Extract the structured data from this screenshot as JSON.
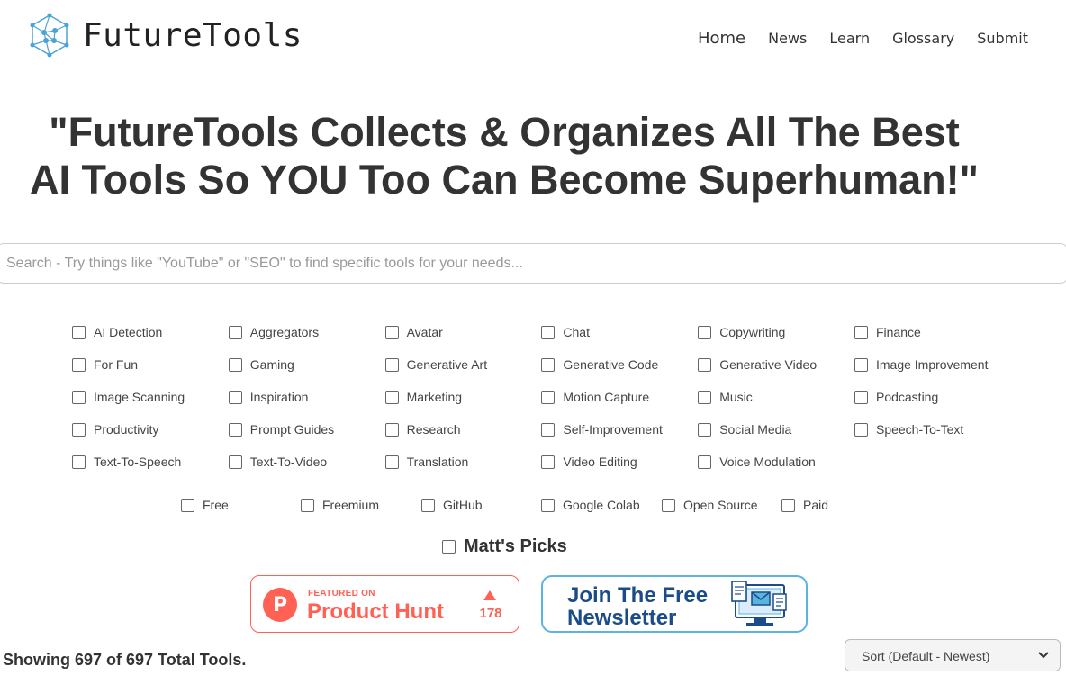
{
  "header": {
    "brand": "FutureTools",
    "nav": [
      "Home",
      "News",
      "Learn",
      "Glossary",
      "Submit"
    ]
  },
  "hero": {
    "line1": "\"FutureTools Collects & Organizes All The Best",
    "line2": "AI Tools So YOU Too Can Become Superhuman!\""
  },
  "search": {
    "placeholder": "Search - Try things like \"YouTube\" or \"SEO\" to find specific tools for your needs..."
  },
  "categories": [
    "AI Detection",
    "Aggregators",
    "Avatar",
    "Chat",
    "Copywriting",
    "Finance",
    "For Fun",
    "Gaming",
    "Generative Art",
    "Generative Code",
    "Generative Video",
    "Image Improvement",
    "Image Scanning",
    "Inspiration",
    "Marketing",
    "Motion Capture",
    "Music",
    "Podcasting",
    "Productivity",
    "Prompt Guides",
    "Research",
    "Self-Improvement",
    "Social Media",
    "Speech-To-Text",
    "Text-To-Speech",
    "Text-To-Video",
    "Translation",
    "Video Editing",
    "Voice Modulation"
  ],
  "pricing": [
    "Free",
    "Freemium",
    "GitHub",
    "Google Colab",
    "Open Source",
    "Paid"
  ],
  "picks_label": "Matt's Picks",
  "product_hunt": {
    "featured": "FEATURED ON",
    "name": "Product Hunt",
    "letter": "P",
    "votes": "178",
    "color": "#ff6154"
  },
  "newsletter": {
    "line1": "Join The Free",
    "line2": "Newsletter",
    "icon": "newsletter-icon",
    "color": "#1b4c8a"
  },
  "results": {
    "showing": "Showing 697 of 697 Total Tools."
  },
  "sort": {
    "selected": "Sort (Default - Newest)"
  }
}
